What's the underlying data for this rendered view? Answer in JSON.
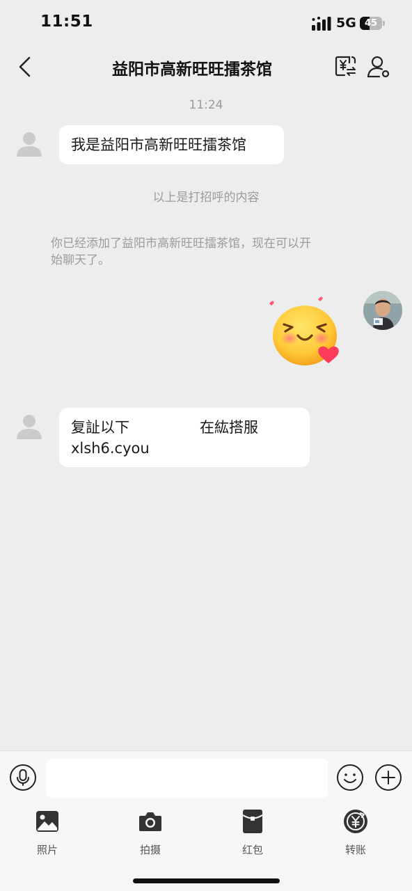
{
  "status_bar": {
    "time": "11:51",
    "network": "5G",
    "battery": "45",
    "battery_level": 0.45
  },
  "header": {
    "title": "益阳市高新旺旺擂茶馆"
  },
  "chat": {
    "timestamp": "11:24",
    "greeting_message": "我是益阳市高新旺旺擂茶馆",
    "greeting_notice": "以上是打招呼的内容",
    "added_notice_line1": "你已经添加了益阳市高新旺旺擂茶馆，现在可以开",
    "added_notice_line2": "始聊天了。",
    "message2_line1_left": "复訨以下",
    "message2_line1_right": "在紘搭服",
    "message2_line2": "xlsh6.cyou"
  },
  "input": {
    "value": "",
    "placeholder": ""
  },
  "quick_actions": [
    {
      "label": "照片",
      "icon": "photo-icon"
    },
    {
      "label": "拍摄",
      "icon": "camera-icon"
    },
    {
      "label": "红包",
      "icon": "red-packet-icon"
    },
    {
      "label": "转账",
      "icon": "transfer-icon"
    }
  ],
  "colors": {
    "background": "#ededed",
    "bubble_received": "#ffffff",
    "system_text": "#9b9b9b",
    "icon_dark": "#333333"
  }
}
